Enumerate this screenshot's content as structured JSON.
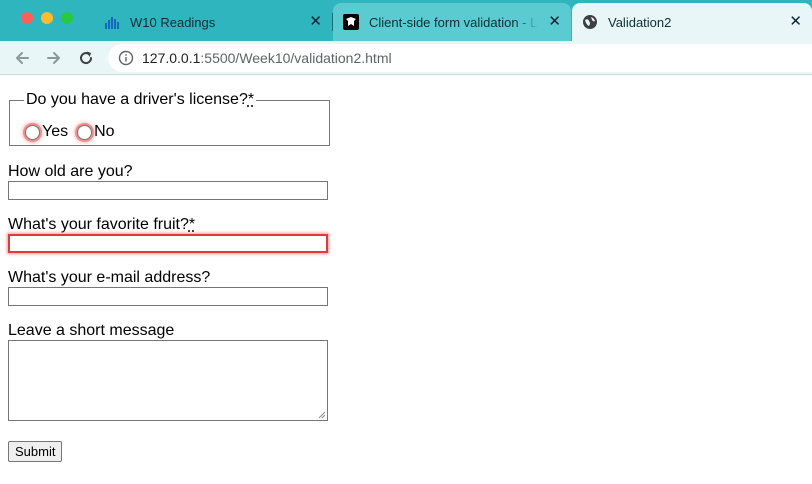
{
  "window": {
    "traffic_lights": [
      "#fe5f57",
      "#febc2e",
      "#28c840"
    ]
  },
  "tabs": [
    {
      "title": "W10 Readings",
      "icon": "bar-chart-icon",
      "active": false
    },
    {
      "title": "Client-side form validation - Le",
      "icon": "mdn-icon",
      "active": false
    },
    {
      "title": "Validation2",
      "icon": "globe-icon",
      "active": true
    }
  ],
  "toolbar": {
    "url_host": "127.0.0.1",
    "url_path": ":5500/Week10/validation2.html"
  },
  "form": {
    "license": {
      "legend": "Do you have a driver's license?",
      "required_mark": "*",
      "options": [
        "Yes",
        "No"
      ]
    },
    "age": {
      "label": "How old are you?",
      "value": ""
    },
    "fruit": {
      "label": "What's your favorite fruit?",
      "required_mark": "*",
      "value": ""
    },
    "email": {
      "label": "What's your e-mail address?",
      "value": ""
    },
    "message": {
      "label": "Leave a short message",
      "value": ""
    },
    "submit_label": "Submit"
  },
  "colors": {
    "tab_bar": "#2fb5bd",
    "toolbar": "#e8f6f7",
    "invalid_outline": "#e03a3a"
  }
}
